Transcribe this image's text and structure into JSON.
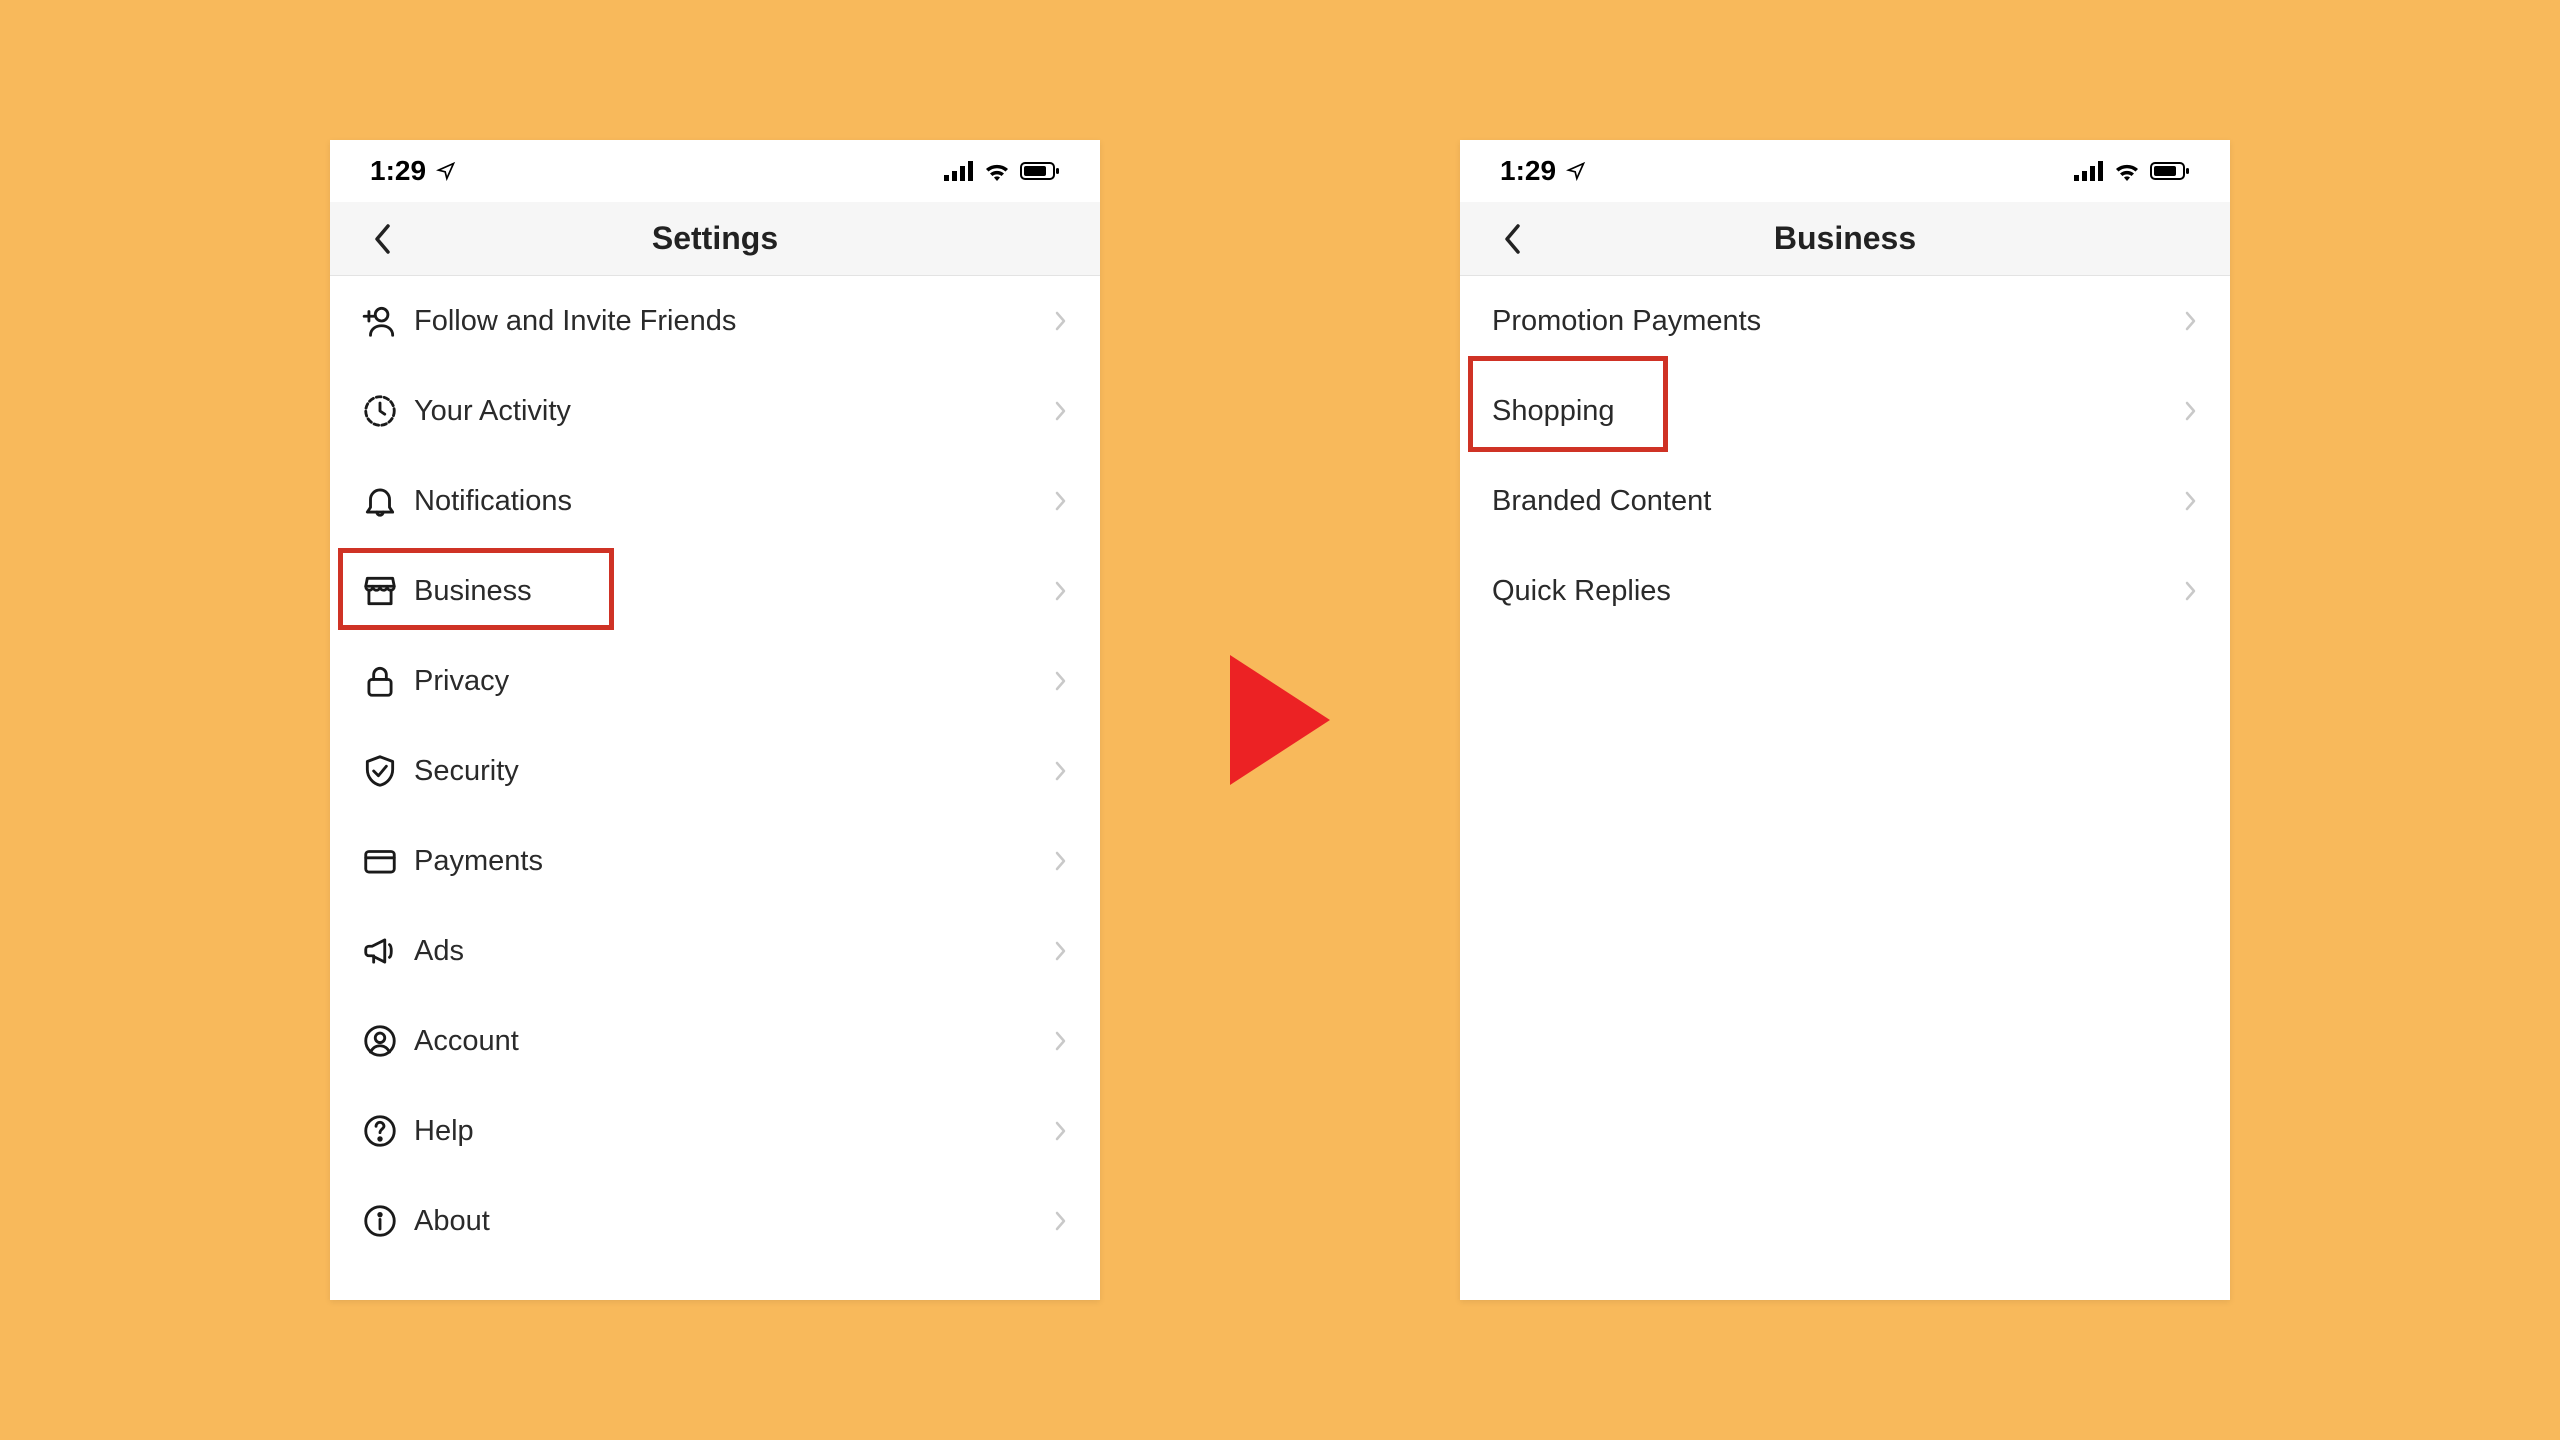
{
  "colors": {
    "background": "#f8b95b",
    "highlight": "#cf3225",
    "arrow": "#ec2224",
    "chevron": "#c9c9c9",
    "iconStroke": "#1a1a1a"
  },
  "statusBar": {
    "time": "1:29",
    "locationIcon": "location-arrow",
    "signalIcon": "cellular-bars",
    "wifiIcon": "wifi",
    "batteryIcon": "battery"
  },
  "leftScreen": {
    "title": "Settings",
    "highlightedIndex": 3,
    "items": [
      {
        "icon": "add-user",
        "label": "Follow and Invite Friends"
      },
      {
        "icon": "activity-clock",
        "label": "Your Activity"
      },
      {
        "icon": "bell",
        "label": "Notifications"
      },
      {
        "icon": "storefront",
        "label": "Business"
      },
      {
        "icon": "lock",
        "label": "Privacy"
      },
      {
        "icon": "shield-check",
        "label": "Security"
      },
      {
        "icon": "credit-card",
        "label": "Payments"
      },
      {
        "icon": "megaphone",
        "label": "Ads"
      },
      {
        "icon": "user-circle",
        "label": "Account"
      },
      {
        "icon": "help-circle",
        "label": "Help"
      },
      {
        "icon": "info-circle",
        "label": "About"
      }
    ]
  },
  "rightScreen": {
    "title": "Business",
    "highlightedIndex": 1,
    "items": [
      {
        "label": "Promotion Payments"
      },
      {
        "label": "Shopping"
      },
      {
        "label": "Branded Content"
      },
      {
        "label": "Quick Replies"
      }
    ]
  }
}
